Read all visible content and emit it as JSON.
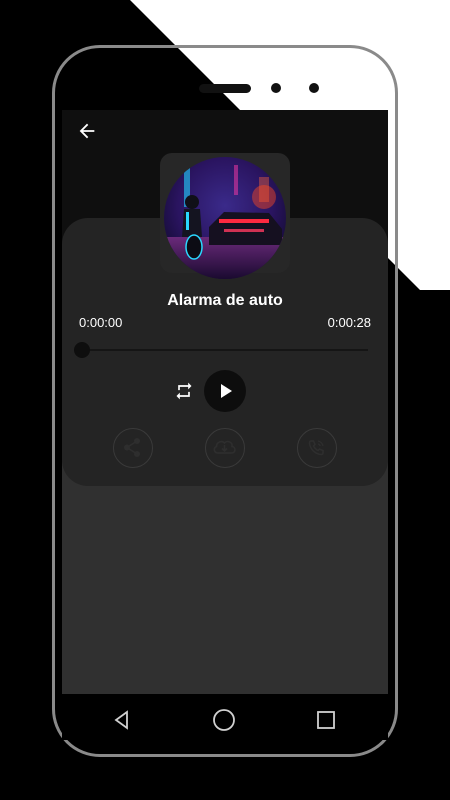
{
  "player": {
    "title": "Alarma de auto",
    "time_current": "0:00:00",
    "time_total": "0:00:28",
    "progress": 0
  },
  "colors": {
    "background": "#000000",
    "screen": "#303030",
    "panel": "#242424",
    "header": "#0f0f0f",
    "accent_text": "#ffffff"
  },
  "icons": {
    "back": "arrow-left-icon",
    "repeat": "repeat-icon",
    "play": "play-icon",
    "share": "share-icon",
    "download": "cloud-download-icon",
    "ringtone": "phone-ringtone-icon",
    "nav_back": "nav-back-icon",
    "nav_home": "nav-home-icon",
    "nav_recent": "nav-recent-icon"
  }
}
